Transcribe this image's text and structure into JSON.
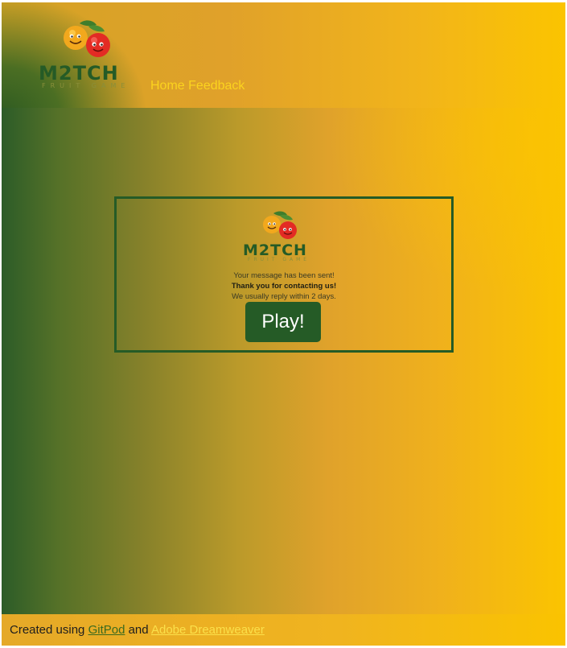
{
  "header": {
    "logo": {
      "title": "M2TCH",
      "subtitle": "FRUIT GAME"
    },
    "nav": {
      "home": "Home",
      "feedback": "Feedback"
    }
  },
  "card": {
    "logo": {
      "title": "M2TCH",
      "subtitle": "FRUIT GAME"
    },
    "line1": "Your message has been sent!",
    "line2": "Thank you for contacting us!",
    "line3": "We usually reply within 2 days.",
    "play_label": "Play!"
  },
  "footer": {
    "prefix": "Created using ",
    "gitpod": "GitPod",
    "middle": " and ",
    "dreamweaver": "Adobe Dreamweaver"
  },
  "colors": {
    "brand_green": "#255b26",
    "accent_yellow": "#fbc400",
    "nav_text": "#fbd31e"
  }
}
